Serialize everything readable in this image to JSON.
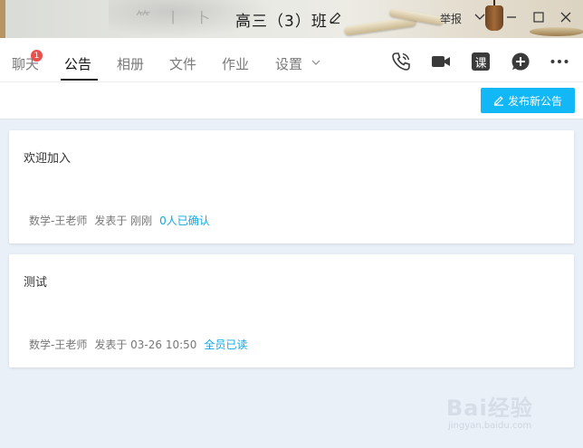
{
  "window": {
    "title": "高三（3）班",
    "report_label": "举报"
  },
  "tabs": [
    {
      "label": "聊天",
      "badge": "1"
    },
    {
      "label": "公告"
    },
    {
      "label": "相册"
    },
    {
      "label": "文件"
    },
    {
      "label": "作业"
    },
    {
      "label": "设置"
    }
  ],
  "toolbar": {
    "class_icon_label": "课",
    "publish_label": "发布新公告"
  },
  "announcements": [
    {
      "title": "欢迎加入",
      "author": "数学-王老师",
      "posted": "发表于 刚刚",
      "status": "0人已确认"
    },
    {
      "title": "测试",
      "author": "数学-王老师",
      "posted": "发表于 03-26 10:50",
      "status": "全员已读"
    }
  ],
  "watermark": {
    "brand": "Bai经验",
    "url": "jingyan.baidu.com"
  },
  "colors": {
    "accent": "#12b7f5",
    "badge": "#e8504b",
    "status_text": "#12a7e0",
    "content_bg": "#eaf0f8"
  }
}
